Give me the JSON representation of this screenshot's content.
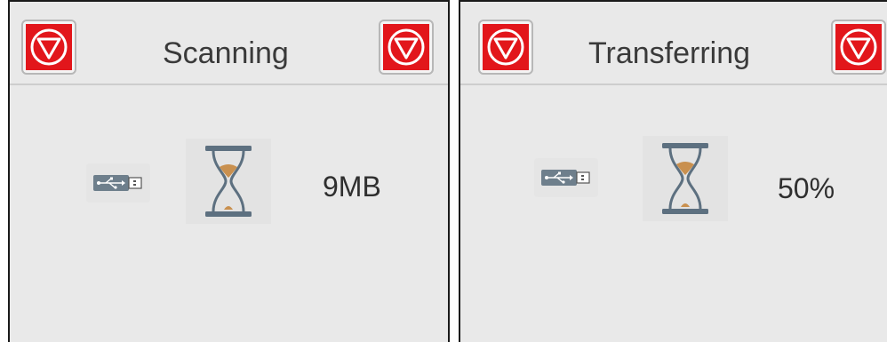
{
  "panels": [
    {
      "title": "Scanning",
      "value": "9MB",
      "stop_left_icon": "stop-icon",
      "stop_right_icon": "stop-icon",
      "device_icon": "usb-drive-icon",
      "status_icon": "hourglass-icon"
    },
    {
      "title": "Transferring",
      "value": "50%",
      "stop_left_icon": "stop-icon",
      "stop_right_icon": "stop-icon",
      "device_icon": "usb-drive-icon",
      "status_icon": "hourglass-icon"
    }
  ],
  "colors": {
    "panel_background": "#e9e9e9",
    "stop_red": "#e2161b",
    "hourglass_sand": "#c9904f",
    "hourglass_frame": "#5d7080",
    "usb_body": "#6e7f8c"
  }
}
